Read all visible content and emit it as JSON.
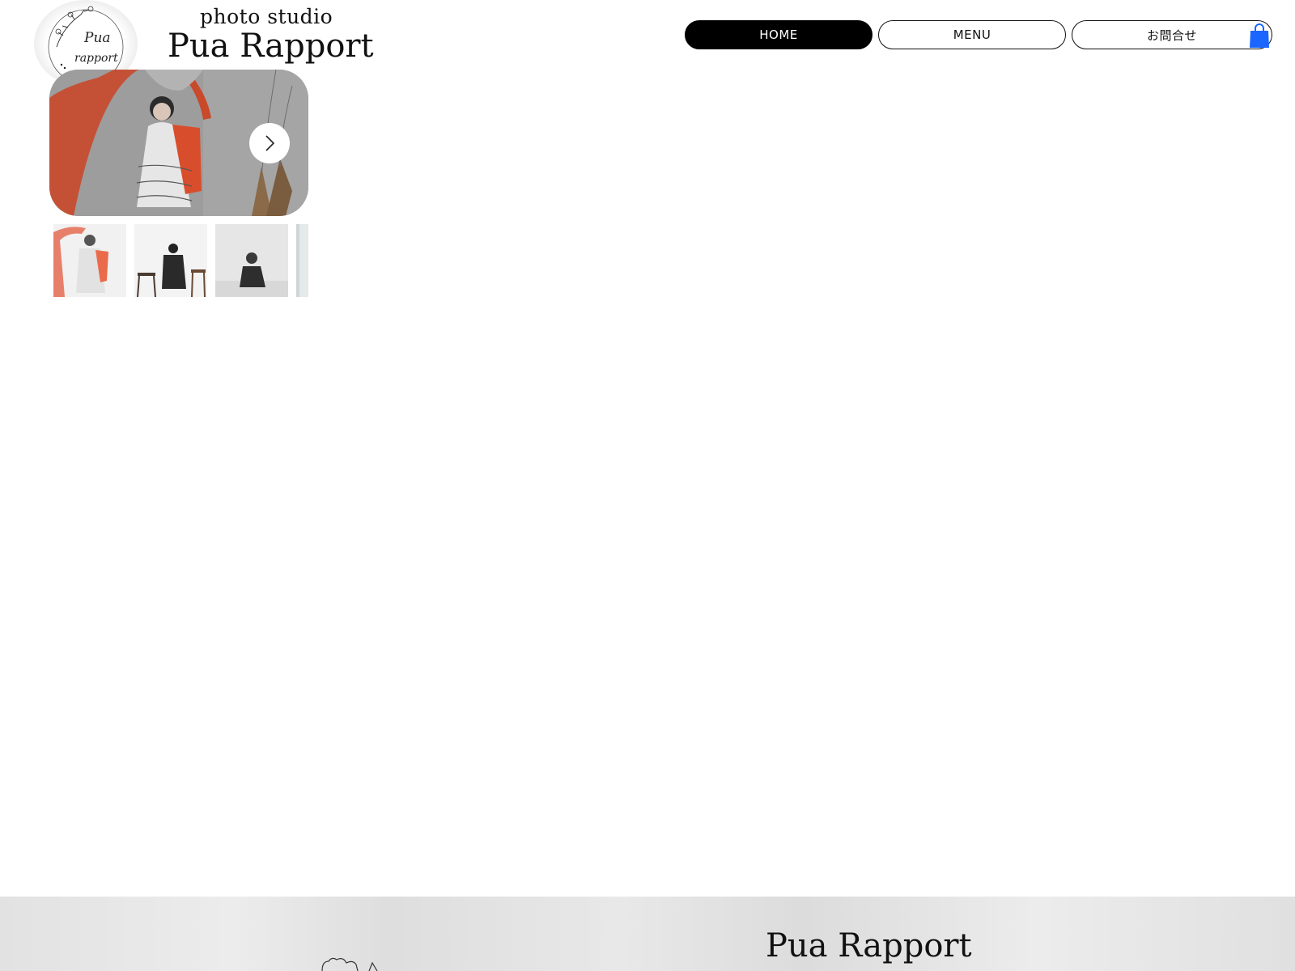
{
  "header": {
    "logo_text_line1": "Pua",
    "logo_text_line2": "rapport",
    "brand_sub": "photo studio",
    "brand_main": "Pua Rapport"
  },
  "nav": {
    "home": "HOME",
    "menu": "MENU",
    "contact": "お問合せ",
    "active": "HOME"
  },
  "cart": {
    "icon": "shopping-bag-icon",
    "color": "#1a66ff"
  },
  "gallery": {
    "next_icon": "chevron-right-icon",
    "thumbnail_count_visible": 4
  },
  "footer": {
    "title": "Pua Rapport"
  },
  "colors": {
    "nav_active_bg": "#000000",
    "nav_active_text": "#ffffff",
    "accent_red": "#e0552f",
    "cart_blue": "#1a66ff",
    "footer_bg": "#e4e4e4"
  }
}
